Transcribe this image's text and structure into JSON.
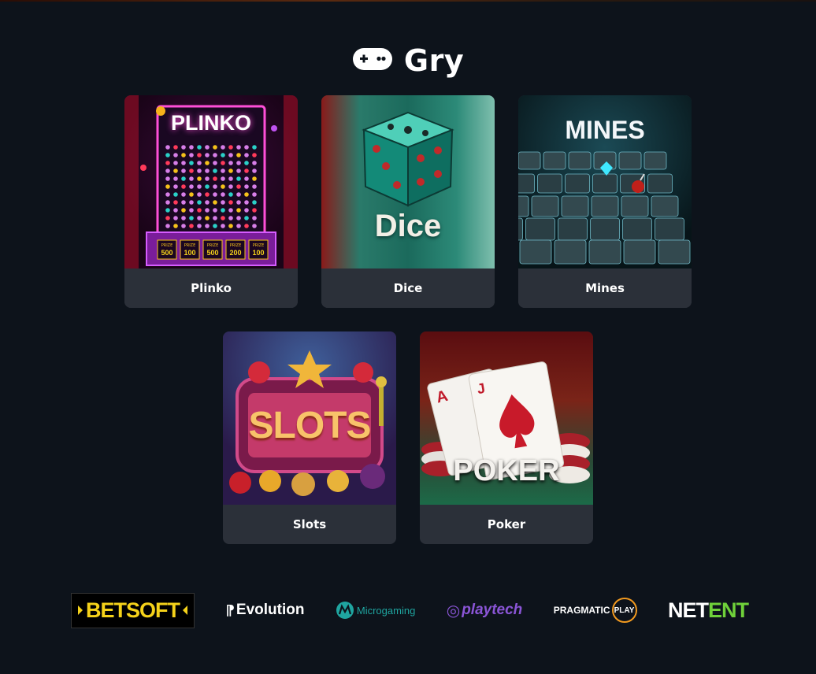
{
  "section": {
    "title": "Gry",
    "icon": "gamepad-icon"
  },
  "games": [
    {
      "name": "Plinko",
      "art_text": "PLINKO",
      "prizes": [
        "500",
        "100",
        "500",
        "200",
        "100"
      ],
      "prize_label": "PRIZE"
    },
    {
      "name": "Dice",
      "art_text": "Dice"
    },
    {
      "name": "Mines",
      "art_text": "MINES"
    },
    {
      "name": "Slots",
      "art_text": "SLOTS"
    },
    {
      "name": "Poker",
      "art_text": "POKER",
      "card_ranks": [
        "A",
        "J"
      ]
    }
  ],
  "providers": [
    {
      "name": "BETSOFT",
      "icon": "betsoft-logo"
    },
    {
      "name": "Evolution",
      "icon": "evolution-logo"
    },
    {
      "name": "Microgaming",
      "icon": "microgaming-logo"
    },
    {
      "name": "playtech",
      "icon": "playtech-logo"
    },
    {
      "name": "PRAGMATIC",
      "name2": "PLAY",
      "icon": "pragmatic-play-logo"
    },
    {
      "name": "NET",
      "name2": "ENT",
      "icon": "netent-logo"
    }
  ],
  "colors": {
    "background": "#0d131b",
    "card_label_bg": "#2b3039",
    "betsoft_yellow": "#f5d21a",
    "microgaming_teal": "#1fa5a0",
    "playtech_purple": "#8a55d6",
    "pragmatic_orange": "#f29a1f",
    "netent_green": "#6fd13a"
  }
}
